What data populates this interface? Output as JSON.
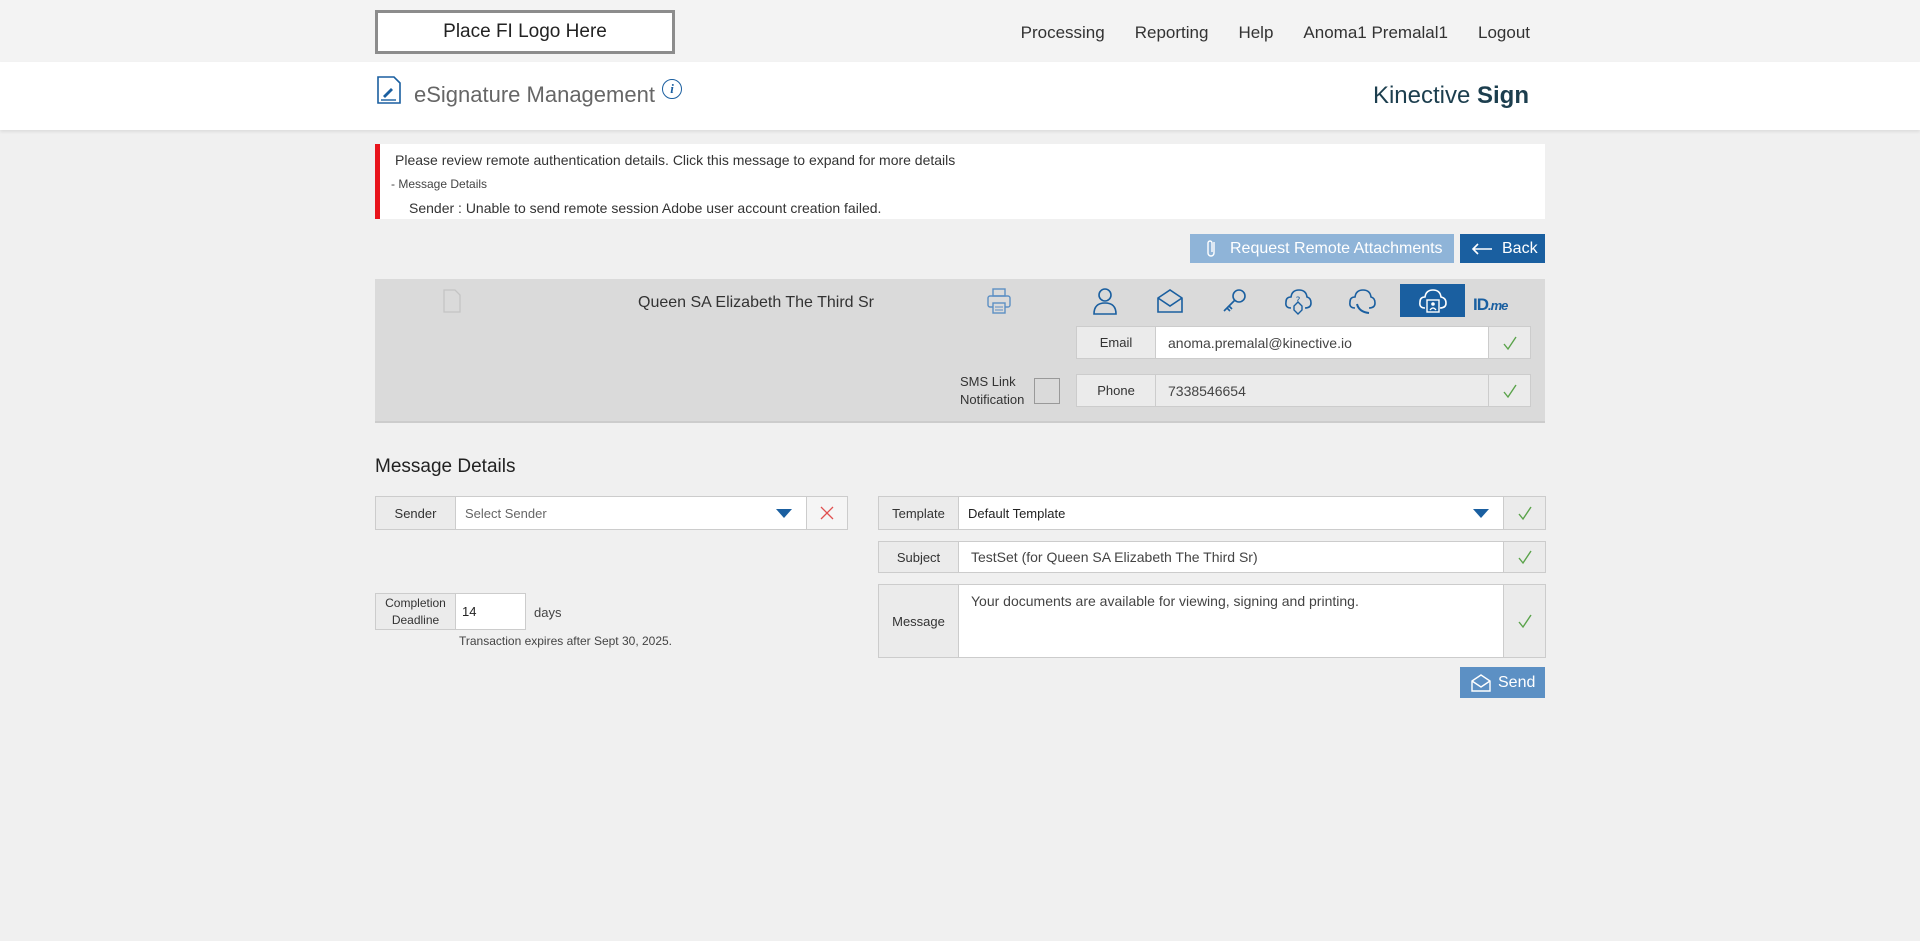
{
  "topbar": {
    "logo_text": "Place FI Logo Here",
    "nav": [
      "Processing",
      "Reporting",
      "Help",
      "Anoma1 Premalal1",
      "Logout"
    ]
  },
  "header": {
    "title": "eSignature Management",
    "info_glyph": "i",
    "brand_light": "Kinective ",
    "brand_bold": "Sign"
  },
  "alert": {
    "line1": "Please review remote authentication details. Click this message to expand for more details",
    "line2": "- Message Details",
    "line3": "Sender :  Unable to send remote session Adobe user account creation failed."
  },
  "actions": {
    "attach_label": "Request Remote Attachments",
    "back_label": "Back",
    "send_label": "Send"
  },
  "recipient": {
    "name": "Queen SA Elizabeth The Third Sr",
    "auth_icons": [
      "person-icon",
      "envelope-icon",
      "key-icon",
      "shield-question-icon",
      "phone-icon",
      "remote-session-icon",
      "idme-logo"
    ],
    "idme_main": "ID",
    "idme_suffix": ".me",
    "email_label": "Email",
    "email_value": "anoma.premalal@kinective.io",
    "phone_label": "Phone",
    "phone_value": "7338546654",
    "sms_label_1": "SMS Link",
    "sms_label_2": "Notification",
    "sms_checked": false
  },
  "message_details": {
    "title": "Message Details",
    "sender_label": "Sender",
    "sender_placeholder": "Select Sender",
    "template_label": "Template",
    "template_value": "Default Template",
    "subject_label": "Subject",
    "subject_value": "TestSet (for Queen SA Elizabeth The Third Sr)",
    "message_label": "Message",
    "message_value": "Your documents are available for viewing, signing and printing.",
    "deadline_label_1": "Completion",
    "deadline_label_2": "Deadline",
    "deadline_value": "14",
    "days_label": "days",
    "expires_text": "Transaction expires after Sept 30, 2025."
  },
  "colors": {
    "primary": "#1a5fa0",
    "alert_bar": "#e8141c",
    "check": "#5aa34a",
    "clear_x": "#e05050"
  }
}
